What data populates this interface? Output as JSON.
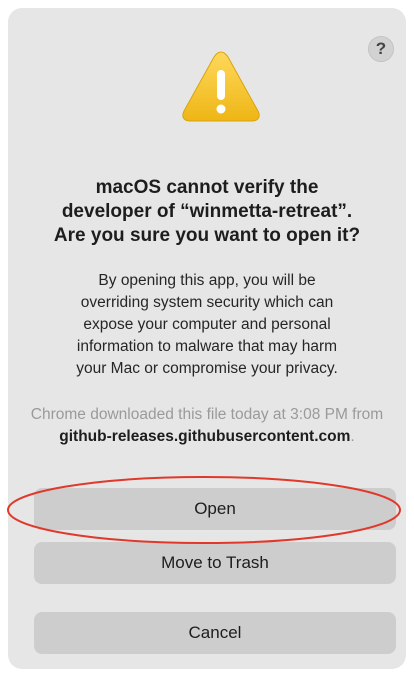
{
  "dialog": {
    "help_label": "?",
    "icon": "warning-triangle-icon",
    "title": "macOS cannot verify the\ndeveloper of “winmetta-retreat”.\nAre you sure you want to open it?",
    "body": "By opening this app, you will be\noverriding system security which can\nexpose your computer and personal\ninformation to malware that may harm\nyour Mac or compromise your privacy.",
    "source_prefix": "Chrome downloaded this file today at 3:08 PM from ",
    "source_host": "github-releases.githubusercontent.com",
    "source_suffix": ".",
    "buttons": {
      "open": "Open",
      "move_to_trash": "Move to Trash",
      "cancel": "Cancel"
    }
  },
  "colors": {
    "dialog_bg": "#e6e6e6",
    "button_bg": "#cdcdcd",
    "warning_yellow": "#f4c430",
    "annotation_red": "#e0392b"
  }
}
